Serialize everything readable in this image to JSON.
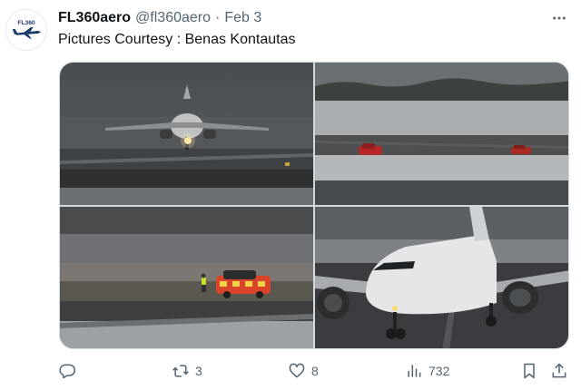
{
  "tweet": {
    "author": {
      "display_name": "FL360aero",
      "handle": "@fl360aero",
      "avatar_text": "FL360"
    },
    "separator": "·",
    "date": "Feb 3",
    "text": "Pictures Courtesy : Benas Kontautas",
    "more_icon": "more-horizontal-icon"
  },
  "media": {
    "photos": [
      {
        "name": "photo-aircraft-approaching-runway"
      },
      {
        "name": "photo-snowy-apron-vehicles"
      },
      {
        "name": "photo-marshaller-follow-me-car"
      },
      {
        "name": "photo-aircraft-nose-closeup"
      }
    ]
  },
  "actions": {
    "reply": {
      "icon": "reply-icon",
      "count": ""
    },
    "retweet": {
      "icon": "retweet-icon",
      "count": "3"
    },
    "like": {
      "icon": "heart-icon",
      "count": "8"
    },
    "views": {
      "icon": "views-chart-icon",
      "count": "732"
    },
    "bookmark": {
      "icon": "bookmark-icon"
    },
    "share": {
      "icon": "share-icon"
    }
  },
  "colors": {
    "text_primary": "#0f1419",
    "text_secondary": "#536471",
    "border": "#cfd9de"
  }
}
